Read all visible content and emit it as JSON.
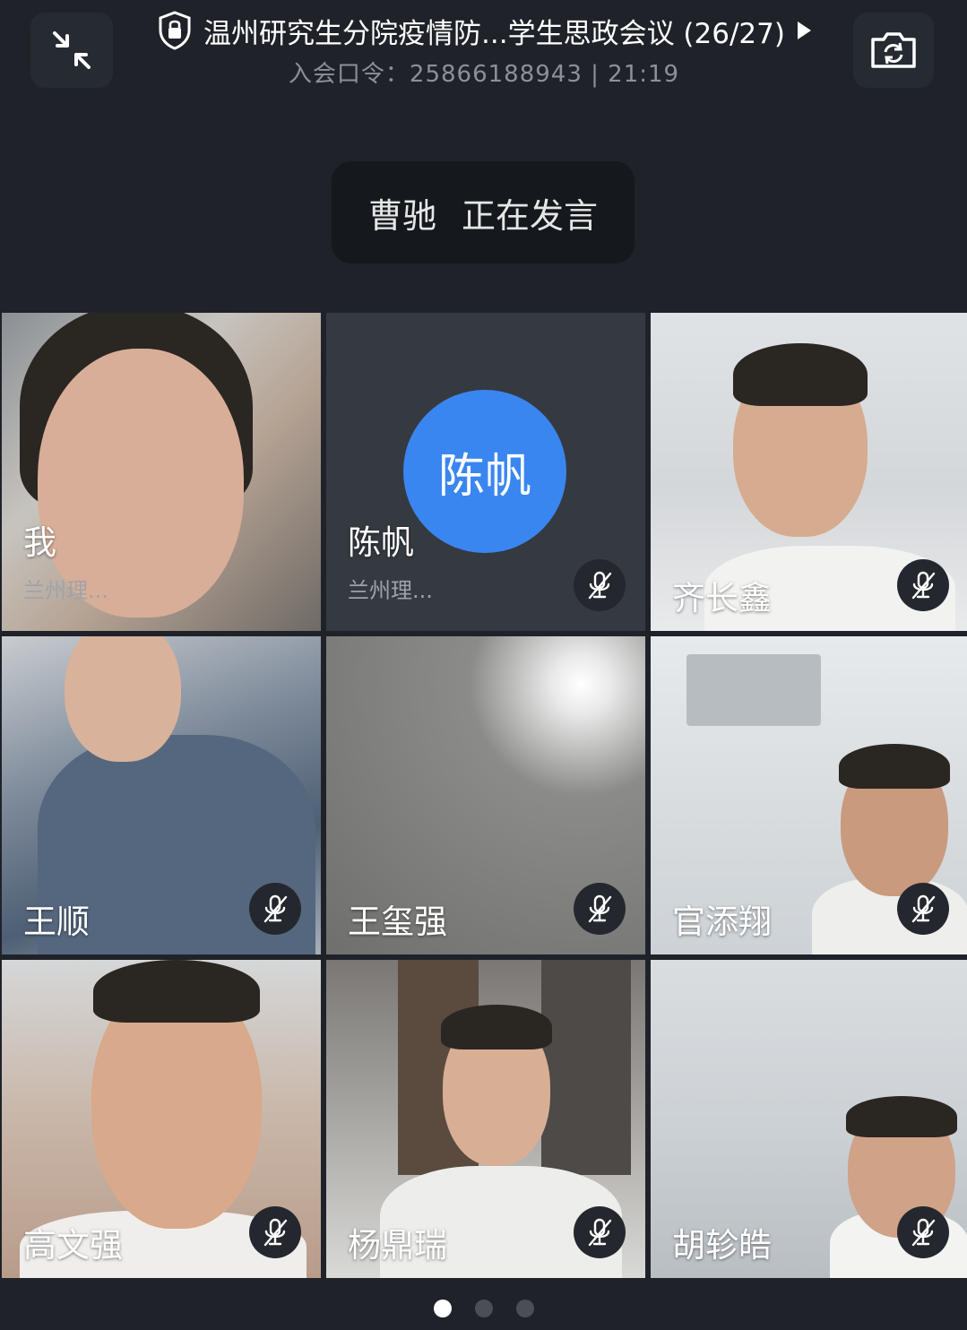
{
  "header": {
    "title": "温州研究生分院疫情防...学生思政会议 (26/27)",
    "meeting_code_label": "入会口令：",
    "meeting_code": "25866188943",
    "separator": " | ",
    "time": "21:19"
  },
  "speaking": {
    "speaker": "曹驰",
    "status": "正在发言"
  },
  "participants": [
    {
      "name": "我",
      "org": "兰州理...",
      "muted": false,
      "video": true
    },
    {
      "name": "陈帆",
      "org": "兰州理...",
      "muted": true,
      "video": false,
      "avatar_text": "陈帆",
      "avatar_color": "#3a86f0"
    },
    {
      "name": "齐长鑫",
      "muted": true,
      "video": true
    },
    {
      "name": "王顺",
      "muted": true,
      "video": true
    },
    {
      "name": "王玺强",
      "muted": true,
      "video": true
    },
    {
      "name": "官添翔",
      "muted": true,
      "video": true
    },
    {
      "name": "高文强",
      "muted": true,
      "video": true
    },
    {
      "name": "杨鼎瑞",
      "muted": true,
      "video": true
    },
    {
      "name": "胡轸皓",
      "muted": true,
      "video": true
    }
  ],
  "pager": {
    "pages": 3,
    "current": 1
  }
}
